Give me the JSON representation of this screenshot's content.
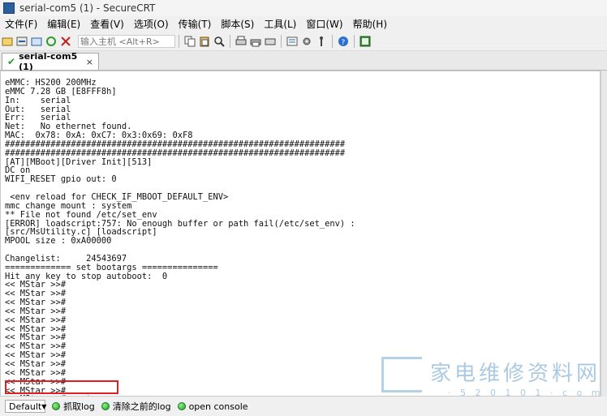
{
  "window": {
    "title": "serial-com5 (1) - SecureCRT"
  },
  "menu": [
    "文件(F)",
    "编辑(E)",
    "查看(V)",
    "选项(O)",
    "传输(T)",
    "脚本(S)",
    "工具(L)",
    "窗口(W)",
    "帮助(H)"
  ],
  "toolbar": {
    "host_input_placeholder": "输入主机 <Alt+R>"
  },
  "tab": {
    "label": "serial-com5 (1)",
    "close": "×"
  },
  "terminal": {
    "text": "eMMC: HS200 200MHz\neMMC 7.28 GB [E8FFF8h]\nIn:    serial\nOut:   serial\nErr:   serial\nNet:   No ethernet found.\nMAC:  0x78: 0xA: 0xC7: 0x3:0x69: 0xF8\n###################################################################\n###################################################################\n[AT][MBoot][Driver Init][513]\nDC on\nWIFI_RESET gpio out: 0\n\n <env reload for CHECK_IF_MBOOT_DEFAULT_ENV>\nmmc change mount : system\n** File not found /etc/set_env\n[ERROR] loadscript:757: No enough buffer or path fail(/etc/set_env) :\n[src/MsUtility.c] [loadscript]\nMPOOL size : 0xA00000\n\nChangelist:     24543697\n============= set bootargs ===============\nHit any key to stop autoboot:  0\n<< MStar >>#\n<< MStar >>#\n<< MStar >>#\n<< MStar >>#\n<< MStar >>#\n<< MStar >>#\n<< MStar >>#\n<< MStar >>#\n<< MStar >>#\n<< MStar >>#\n<< MStar >>#\n<< MStar >>#\n<< MStar >>#\n<< MStar >># custar"
  },
  "watermark": {
    "text": "家电维修资料网",
    "url": "· 5 2 0 1 0 1 · c o m"
  },
  "statusbar": {
    "session_select": "Default",
    "buttons": [
      "抓取log",
      "清除之前的log",
      "open console"
    ]
  },
  "colors": {
    "highlight_box": "#e02020",
    "button_dot": "#1f9a1f",
    "check": "#2a9d2a"
  }
}
